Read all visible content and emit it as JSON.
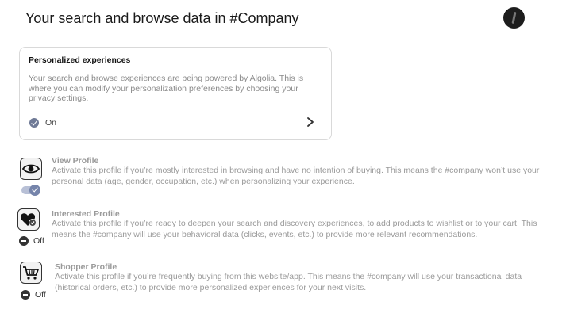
{
  "header": {
    "title": "Your search and browse data in #Company",
    "avatar_icon": "user-avatar"
  },
  "personalized_card": {
    "title": "Personalized experiences",
    "description": "Your search and browse experiences are being powered by Algolia. This is where you can modify your personalization preferences by choosing your privacy settings.",
    "status_label": "On",
    "status_icon": "check-circle-icon",
    "action_icon": "chevron-right-icon"
  },
  "profiles": [
    {
      "icon": "eye-icon",
      "title": "View Profile",
      "description": "Activate this profile if you’re mostly interested in browsing and have no intention of buying. This means the #company won’t use your personal data (age, gender, occupation, etc.) when personalizing your experience.",
      "state": "on",
      "state_label": ""
    },
    {
      "icon": "heart-check-icon",
      "title": "Interested Profile",
      "description": "Activate this profile if you’re ready to deepen your search and discovery experiences, to add products to wishlist or to your cart. This means the #company will use your behavioral data (clicks, events, etc.) to provide more relevant recommendations.",
      "state": "off",
      "state_label": "Off"
    },
    {
      "icon": "shopping-cart-icon",
      "title": "Shopper Profile",
      "description": "Activate this profile if you’re frequently buying from this website/app. This means the #company will use your transactional data (historical orders, etc.) to provide more personalized experiences for your next visits.",
      "state": "off",
      "state_label": "Off"
    }
  ],
  "colors": {
    "accent": "#6f7a96",
    "muted_text": "#9a9a9a",
    "divider": "#dcdcdc"
  }
}
